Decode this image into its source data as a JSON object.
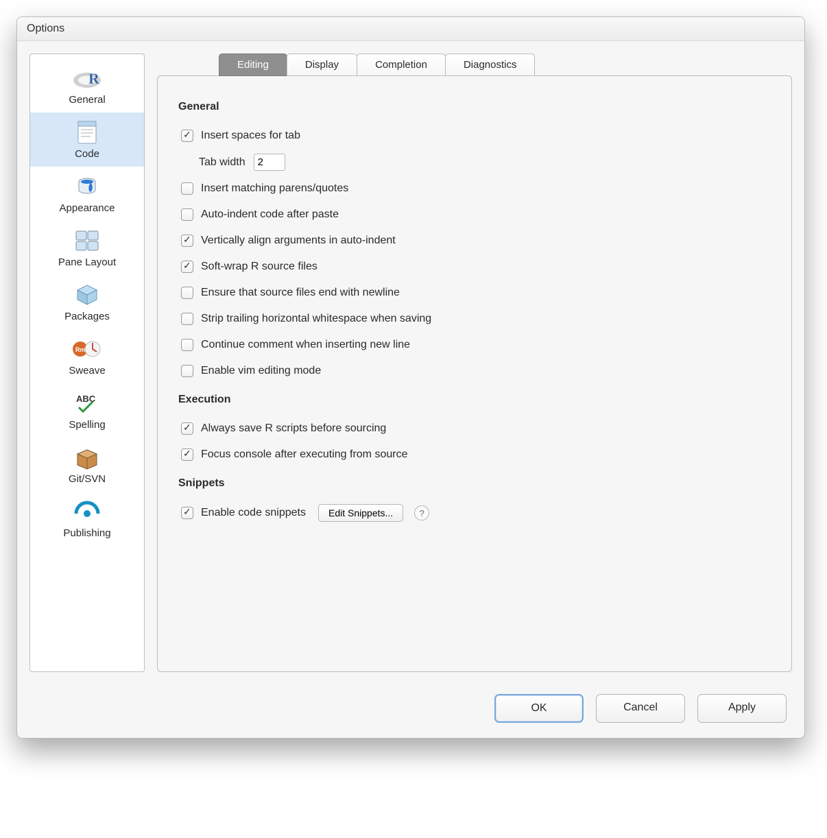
{
  "window": {
    "title": "Options"
  },
  "sidebar": {
    "items": [
      {
        "label": "General"
      },
      {
        "label": "Code"
      },
      {
        "label": "Appearance"
      },
      {
        "label": "Pane Layout"
      },
      {
        "label": "Packages"
      },
      {
        "label": "Sweave"
      },
      {
        "label": "Spelling"
      },
      {
        "label": "Git/SVN"
      },
      {
        "label": "Publishing"
      }
    ]
  },
  "tabs": {
    "editing": "Editing",
    "display": "Display",
    "completion": "Completion",
    "diagnostics": "Diagnostics"
  },
  "sections": {
    "general": "General",
    "execution": "Execution",
    "snippets": "Snippets"
  },
  "options": {
    "insert_spaces_for_tab": "Insert spaces for tab",
    "tab_width_label": "Tab width",
    "tab_width_value": "2",
    "insert_matching": "Insert matching parens/quotes",
    "auto_indent_paste": "Auto-indent code after paste",
    "vert_align": "Vertically align arguments in auto-indent",
    "soft_wrap": "Soft-wrap R source files",
    "ensure_newline": "Ensure that source files end with newline",
    "strip_trailing": "Strip trailing horizontal whitespace when saving",
    "continue_comment": "Continue comment when inserting new line",
    "vim_mode": "Enable vim editing mode",
    "always_save": "Always save R scripts before sourcing",
    "focus_console": "Focus console after executing from source",
    "enable_snippets": "Enable code snippets",
    "edit_snippets_btn": "Edit Snippets...",
    "help_btn": "?"
  },
  "footer": {
    "ok": "OK",
    "cancel": "Cancel",
    "apply": "Apply"
  }
}
